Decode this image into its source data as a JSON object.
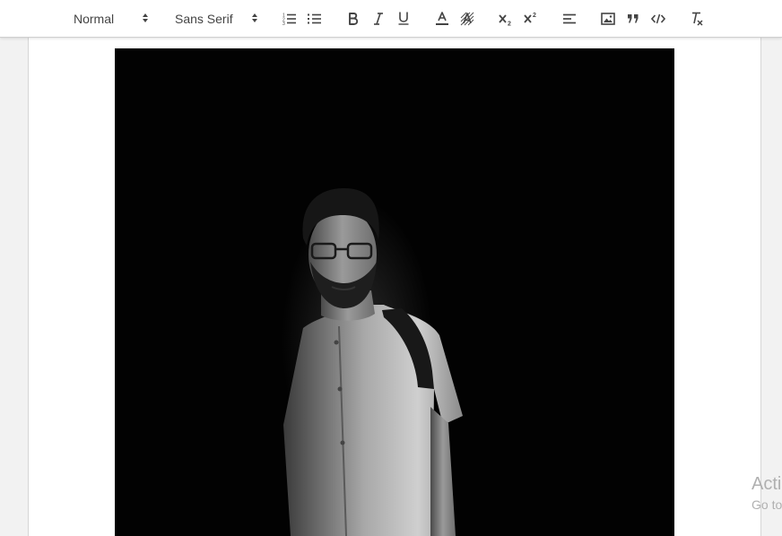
{
  "toolbar": {
    "header_picker": {
      "value": "Normal"
    },
    "font_picker": {
      "value": "Sans Serif"
    },
    "buttons": [
      {
        "name": "ordered-list-button",
        "icon": "ordered-list-icon"
      },
      {
        "name": "bullet-list-button",
        "icon": "bullet-list-icon"
      },
      {
        "name": "bold-button",
        "icon": "bold-icon"
      },
      {
        "name": "italic-button",
        "icon": "italic-icon"
      },
      {
        "name": "underline-button",
        "icon": "underline-icon"
      },
      {
        "name": "text-color-button",
        "icon": "text-color-icon"
      },
      {
        "name": "background-color-button",
        "icon": "background-color-icon"
      },
      {
        "name": "subscript-button",
        "icon": "subscript-icon"
      },
      {
        "name": "superscript-button",
        "icon": "superscript-icon"
      },
      {
        "name": "align-button",
        "icon": "align-left-icon"
      },
      {
        "name": "image-button",
        "icon": "image-icon"
      },
      {
        "name": "blockquote-button",
        "icon": "blockquote-icon"
      },
      {
        "name": "code-block-button",
        "icon": "code-icon"
      },
      {
        "name": "clear-formatting-button",
        "icon": "clear-formatting-icon"
      }
    ]
  },
  "editor": {
    "image": {
      "description": "black and white portrait photo of a man with glasses and a backpack strap"
    }
  },
  "watermark": {
    "line1": "Acti",
    "line2": "Go to"
  },
  "colors": {
    "toolbar_background": "#ffffff",
    "icon_color": "#444444",
    "page_background": "#ffffff",
    "workspace_background": "#f2f2f2"
  }
}
